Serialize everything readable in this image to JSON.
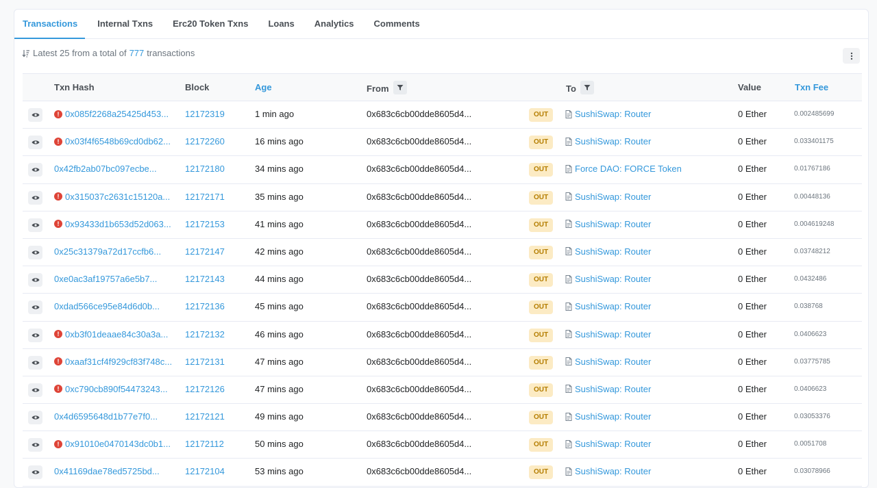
{
  "tabs": [
    "Transactions",
    "Internal Txns",
    "Erc20 Token Txns",
    "Loans",
    "Analytics",
    "Comments"
  ],
  "summary": {
    "prefix": "Latest 25 from a total of",
    "count": "777",
    "suffix": "transactions"
  },
  "columns": {
    "txn_hash": "Txn Hash",
    "block": "Block",
    "age": "Age",
    "from": "From",
    "to": "To",
    "value": "Value",
    "txn_fee": "Txn Fee"
  },
  "colors": {
    "link": "#3498db",
    "error": "#de4437",
    "out_bg": "#fcebc4",
    "out_text": "#b47d00"
  },
  "rows": [
    {
      "error": true,
      "hash": "0x085f2268a25425d453...",
      "block": "12172319",
      "age": "1 min ago",
      "from": "0x683c6cb00dde8605d4...",
      "dir": "OUT",
      "to": "SushiSwap: Router",
      "value": "0 Ether",
      "fee": "0.002485699"
    },
    {
      "error": true,
      "hash": "0x03f4f6548b69cd0db62...",
      "block": "12172260",
      "age": "16 mins ago",
      "from": "0x683c6cb00dde8605d4...",
      "dir": "OUT",
      "to": "SushiSwap: Router",
      "value": "0 Ether",
      "fee": "0.033401175"
    },
    {
      "error": false,
      "hash": "0x42fb2ab07bc097ecbe...",
      "block": "12172180",
      "age": "34 mins ago",
      "from": "0x683c6cb00dde8605d4...",
      "dir": "OUT",
      "to": "Force DAO: FORCE Token",
      "value": "0 Ether",
      "fee": "0.01767186"
    },
    {
      "error": true,
      "hash": "0x315037c2631c15120a...",
      "block": "12172171",
      "age": "35 mins ago",
      "from": "0x683c6cb00dde8605d4...",
      "dir": "OUT",
      "to": "SushiSwap: Router",
      "value": "0 Ether",
      "fee": "0.00448136"
    },
    {
      "error": true,
      "hash": "0x93433d1b653d52d063...",
      "block": "12172153",
      "age": "41 mins ago",
      "from": "0x683c6cb00dde8605d4...",
      "dir": "OUT",
      "to": "SushiSwap: Router",
      "value": "0 Ether",
      "fee": "0.004619248"
    },
    {
      "error": false,
      "hash": "0x25c31379a72d17ccfb6...",
      "block": "12172147",
      "age": "42 mins ago",
      "from": "0x683c6cb00dde8605d4...",
      "dir": "OUT",
      "to": "SushiSwap: Router",
      "value": "0 Ether",
      "fee": "0.03748212"
    },
    {
      "error": false,
      "hash": "0xe0ac3af19757a6e5b7...",
      "block": "12172143",
      "age": "44 mins ago",
      "from": "0x683c6cb00dde8605d4...",
      "dir": "OUT",
      "to": "SushiSwap: Router",
      "value": "0 Ether",
      "fee": "0.0432486"
    },
    {
      "error": false,
      "hash": "0xdad566ce95e84d6d0b...",
      "block": "12172136",
      "age": "45 mins ago",
      "from": "0x683c6cb00dde8605d4...",
      "dir": "OUT",
      "to": "SushiSwap: Router",
      "value": "0 Ether",
      "fee": "0.038768"
    },
    {
      "error": true,
      "hash": "0xb3f01deaae84c30a3a...",
      "block": "12172132",
      "age": "46 mins ago",
      "from": "0x683c6cb00dde8605d4...",
      "dir": "OUT",
      "to": "SushiSwap: Router",
      "value": "0 Ether",
      "fee": "0.0406623"
    },
    {
      "error": true,
      "hash": "0xaaf31cf4f929cf83f748c...",
      "block": "12172131",
      "age": "47 mins ago",
      "from": "0x683c6cb00dde8605d4...",
      "dir": "OUT",
      "to": "SushiSwap: Router",
      "value": "0 Ether",
      "fee": "0.03775785"
    },
    {
      "error": true,
      "hash": "0xc790cb890f54473243...",
      "block": "12172126",
      "age": "47 mins ago",
      "from": "0x683c6cb00dde8605d4...",
      "dir": "OUT",
      "to": "SushiSwap: Router",
      "value": "0 Ether",
      "fee": "0.0406623"
    },
    {
      "error": false,
      "hash": "0x4d6595648d1b77e7f0...",
      "block": "12172121",
      "age": "49 mins ago",
      "from": "0x683c6cb00dde8605d4...",
      "dir": "OUT",
      "to": "SushiSwap: Router",
      "value": "0 Ether",
      "fee": "0.03053376"
    },
    {
      "error": true,
      "hash": "0x91010e0470143dc0b1...",
      "block": "12172112",
      "age": "50 mins ago",
      "from": "0x683c6cb00dde8605d4...",
      "dir": "OUT",
      "to": "SushiSwap: Router",
      "value": "0 Ether",
      "fee": "0.0051708"
    },
    {
      "error": false,
      "hash": "0x41169dae78ed5725bd...",
      "block": "12172104",
      "age": "53 mins ago",
      "from": "0x683c6cb00dde8605d4...",
      "dir": "OUT",
      "to": "SushiSwap: Router",
      "value": "0 Ether",
      "fee": "0.03078966"
    }
  ]
}
